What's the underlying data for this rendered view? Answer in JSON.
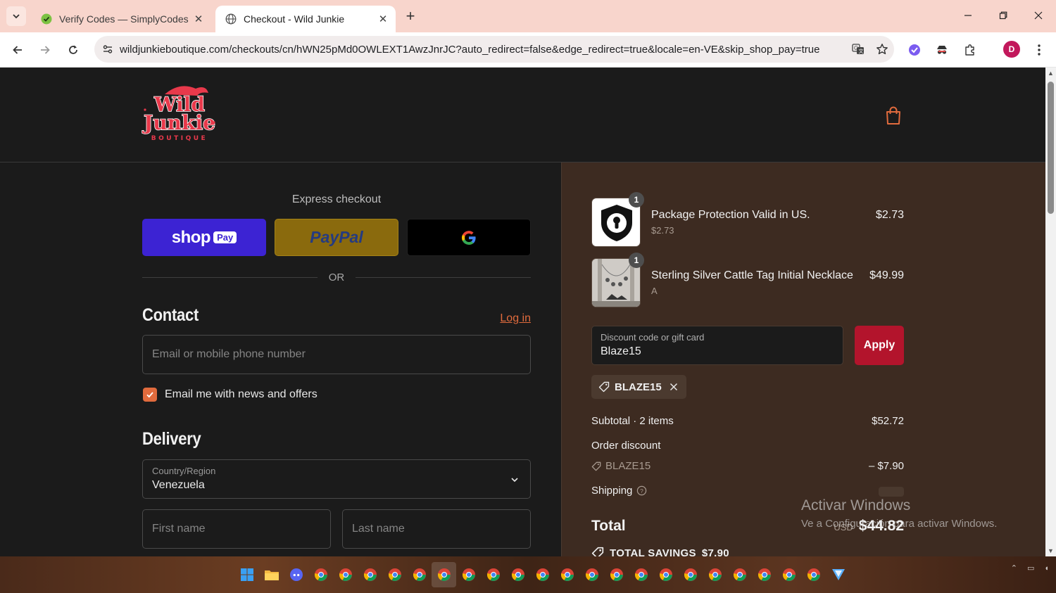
{
  "browser": {
    "tabs": [
      {
        "title": "Verify Codes — SimplyCodes",
        "icon": "simplycodes-favicon",
        "active": false
      },
      {
        "title": "Checkout - Wild Junkie",
        "icon": "globe-favicon",
        "active": true
      }
    ],
    "url": "wildjunkieboutique.com/checkouts/cn/hWN25pMd0OWLEXT1AwzJnrJC?auto_redirect=false&edge_redirect=true&locale=en-VE&skip_shop_pay=true",
    "profile_initial": "D"
  },
  "store": {
    "logo_text_top": "Wild",
    "logo_text_mid": "Junkie",
    "logo_text_bottom": "BOUTIQUE"
  },
  "checkout": {
    "express_title": "Express checkout",
    "shop_pay_label": "shop",
    "shop_pay_badge": "Pay",
    "paypal_label": "PayPal",
    "or_label": "OR",
    "contact_title": "Contact",
    "login_label": "Log in",
    "email_placeholder": "Email or mobile phone number",
    "news_checkbox_label": "Email me with news and offers",
    "news_checked": true,
    "delivery_title": "Delivery",
    "country_label": "Country/Region",
    "country_value": "Venezuela",
    "first_name_placeholder": "First name",
    "last_name_placeholder": "Last name"
  },
  "summary": {
    "items": [
      {
        "name": "Package Protection Valid in US.",
        "sub": "$2.73",
        "price": "$2.73",
        "qty": "1"
      },
      {
        "name": "Sterling Silver Cattle Tag Initial Necklace",
        "sub": "A",
        "price": "$49.99",
        "qty": "1"
      }
    ],
    "discount_label": "Discount code or gift card",
    "discount_value": "Blaze15",
    "apply_label": "Apply",
    "applied_code": "BLAZE15",
    "subtotal_label": "Subtotal · 2 items",
    "subtotal_value": "$52.72",
    "order_discount_label": "Order discount",
    "discount_code": "BLAZE15",
    "discount_amount": "– $7.90",
    "shipping_label": "Shipping",
    "total_label": "Total",
    "currency": "USD",
    "total_value": "$44.82",
    "savings_label": "TOTAL SAVINGS",
    "savings_value": "$7.90"
  },
  "watermark": {
    "line1": "Activar Windows",
    "line2": "Ve a Configuración para activar Windows."
  },
  "colors": {
    "accent": "#e16b3d",
    "apply": "#b3142c",
    "summary_bg": "#3d2b21",
    "shop_pay": "#3c23d3",
    "paypal": "#8a6a0d"
  }
}
